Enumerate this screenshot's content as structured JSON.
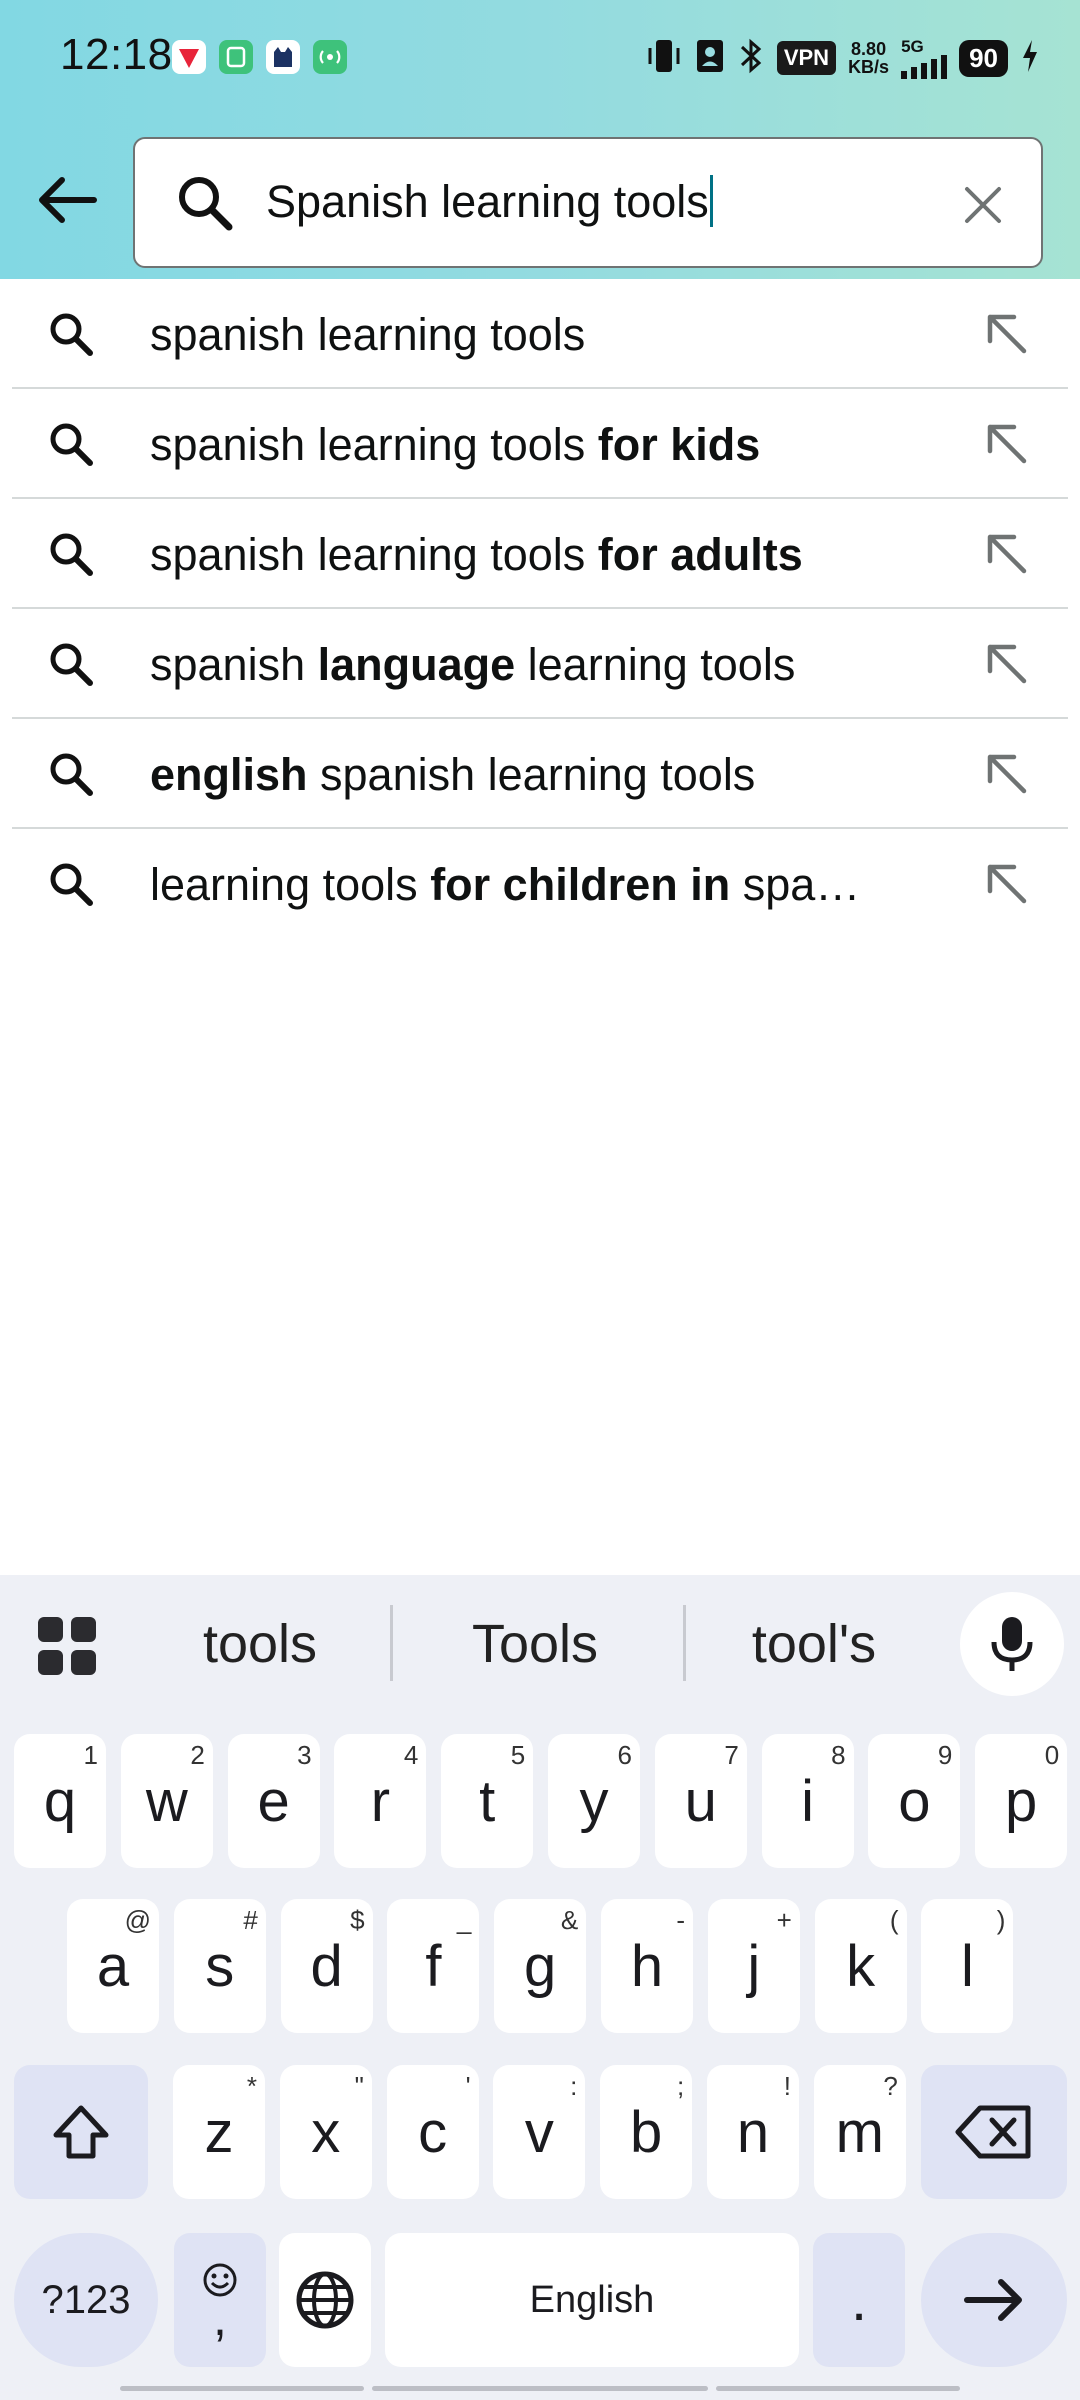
{
  "status_bar": {
    "time": "12:18",
    "vpn": "VPN",
    "net_speed_value": "8.80",
    "net_speed_unit": "KB/s",
    "network": "5G",
    "battery": "90"
  },
  "search": {
    "query": "Spanish learning tools"
  },
  "suggestions": [
    {
      "parts": [
        {
          "t": "spanish learning tools",
          "b": false
        }
      ]
    },
    {
      "parts": [
        {
          "t": "spanish learning tools ",
          "b": false
        },
        {
          "t": "for kids",
          "b": true
        }
      ]
    },
    {
      "parts": [
        {
          "t": "spanish learning tools ",
          "b": false
        },
        {
          "t": "for adults",
          "b": true
        }
      ]
    },
    {
      "parts": [
        {
          "t": "spanish ",
          "b": false
        },
        {
          "t": "language",
          "b": true
        },
        {
          "t": " learning tools",
          "b": false
        }
      ]
    },
    {
      "parts": [
        {
          "t": "english",
          "b": true
        },
        {
          "t": " spanish learning tools",
          "b": false
        }
      ]
    },
    {
      "parts": [
        {
          "t": "learning tools ",
          "b": false
        },
        {
          "t": "for children in",
          "b": true
        },
        {
          "t": " spa…",
          "b": false
        }
      ]
    }
  ],
  "keyboard": {
    "word_suggestions": [
      "tools",
      "Tools",
      "tool's"
    ],
    "row1": [
      {
        "k": "q",
        "h": "1"
      },
      {
        "k": "w",
        "h": "2"
      },
      {
        "k": "e",
        "h": "3"
      },
      {
        "k": "r",
        "h": "4"
      },
      {
        "k": "t",
        "h": "5"
      },
      {
        "k": "y",
        "h": "6"
      },
      {
        "k": "u",
        "h": "7"
      },
      {
        "k": "i",
        "h": "8"
      },
      {
        "k": "o",
        "h": "9"
      },
      {
        "k": "p",
        "h": "0"
      }
    ],
    "row2": [
      {
        "k": "a",
        "h": "@"
      },
      {
        "k": "s",
        "h": "#"
      },
      {
        "k": "d",
        "h": "$"
      },
      {
        "k": "f",
        "h": "_"
      },
      {
        "k": "g",
        "h": "&"
      },
      {
        "k": "h",
        "h": "-"
      },
      {
        "k": "j",
        "h": "+"
      },
      {
        "k": "k",
        "h": "("
      },
      {
        "k": "l",
        "h": ")"
      }
    ],
    "row3": [
      {
        "k": "z",
        "h": "*"
      },
      {
        "k": "x",
        "h": "\""
      },
      {
        "k": "c",
        "h": "'"
      },
      {
        "k": "v",
        "h": ":"
      },
      {
        "k": "b",
        "h": ";"
      },
      {
        "k": "n",
        "h": "!"
      },
      {
        "k": "m",
        "h": "?"
      }
    ],
    "symbols_label": "?123",
    "comma_label": ",",
    "space_label": "English",
    "period_label": "."
  },
  "colors": {
    "header_gradient_start": "#82d8e3",
    "header_gradient_end": "#a6e3d3",
    "caret": "#007185",
    "keyboard_bg": "#eef0f6",
    "func_key": "#dfe3f4"
  },
  "icons": {
    "back": "arrow-left-icon",
    "search": "magnifier-icon",
    "clear": "x-icon",
    "suggestion_fill": "arrow-up-left-icon",
    "keyboard_menu": "grid-icon",
    "mic": "microphone-icon",
    "shift": "shift-arrow-icon",
    "backspace": "backspace-icon",
    "emoji": "smiley-icon",
    "language": "globe-icon",
    "enter": "arrow-right-icon"
  }
}
